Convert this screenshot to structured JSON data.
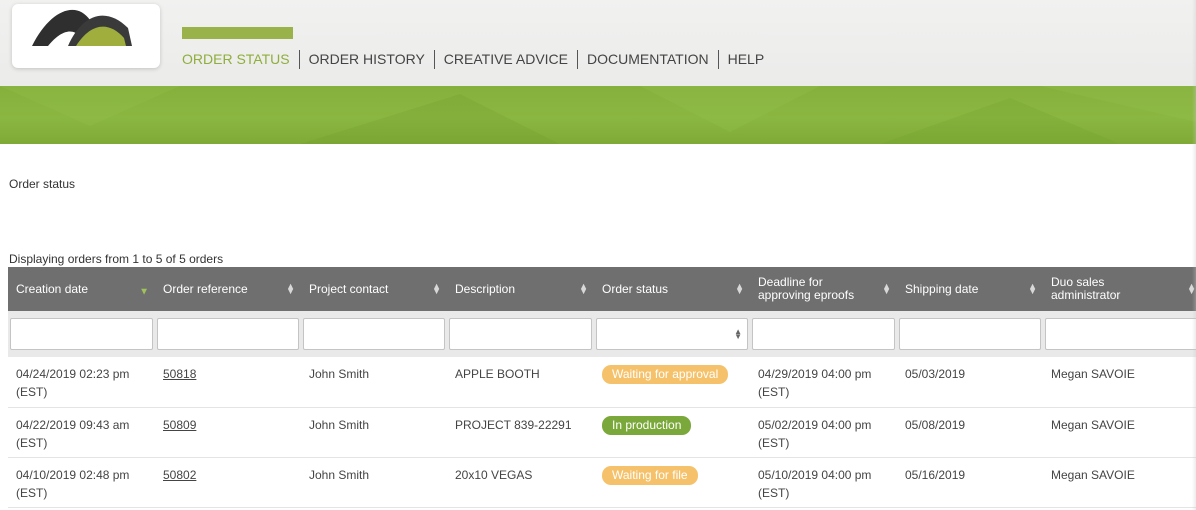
{
  "nav": {
    "items": [
      {
        "label": "ORDER STATUS",
        "active": true
      },
      {
        "label": "ORDER HISTORY",
        "active": false
      },
      {
        "label": "CREATIVE ADVICE",
        "active": false
      },
      {
        "label": "DOCUMENTATION",
        "active": false
      },
      {
        "label": "HELP",
        "active": false
      }
    ]
  },
  "page": {
    "title": "Order status",
    "display_info": "Displaying orders from 1 to 5 of 5 orders"
  },
  "table": {
    "headers": [
      {
        "label": "Creation date",
        "sort": "active"
      },
      {
        "label": "Order reference",
        "sort": "both"
      },
      {
        "label": "Project contact",
        "sort": "both"
      },
      {
        "label": "Description",
        "sort": "both"
      },
      {
        "label": "Order status",
        "sort": "both"
      },
      {
        "label": "Deadline for approving eproofs",
        "sort": "both"
      },
      {
        "label": "Shipping date",
        "sort": "both"
      },
      {
        "label": "Duo sales administrator",
        "sort": "both"
      }
    ],
    "rows": [
      {
        "creation_date": "04/24/2019 02:23 pm (EST)",
        "reference": "50818",
        "contact": "John Smith",
        "description": "APPLE BOOTH",
        "status": "Waiting for approval",
        "status_color": "#f5c26b",
        "deadline": "04/29/2019 04:00 pm (EST)",
        "shipping": "05/03/2019",
        "admin": "Megan SAVOIE"
      },
      {
        "creation_date": "04/22/2019 09:43 am (EST)",
        "reference": "50809",
        "contact": "John Smith",
        "description": "PROJECT 839-22291",
        "status": "In production",
        "status_color": "#7aa83a",
        "deadline": "05/02/2019 04:00 pm (EST)",
        "shipping": "05/08/2019",
        "admin": "Megan SAVOIE"
      },
      {
        "creation_date": "04/10/2019 02:48 pm (EST)",
        "reference": "50802",
        "contact": "John Smith",
        "description": "20x10 VEGAS",
        "status": "Waiting for file",
        "status_color": "#f5c26b",
        "deadline": "05/10/2019 04:00 pm (EST)",
        "shipping": "05/16/2019",
        "admin": "Megan SAVOIE"
      }
    ]
  },
  "colors": {
    "accent_green": "#8fae3b",
    "header_band": "#86b03c",
    "table_header": "#6f6f6f"
  }
}
